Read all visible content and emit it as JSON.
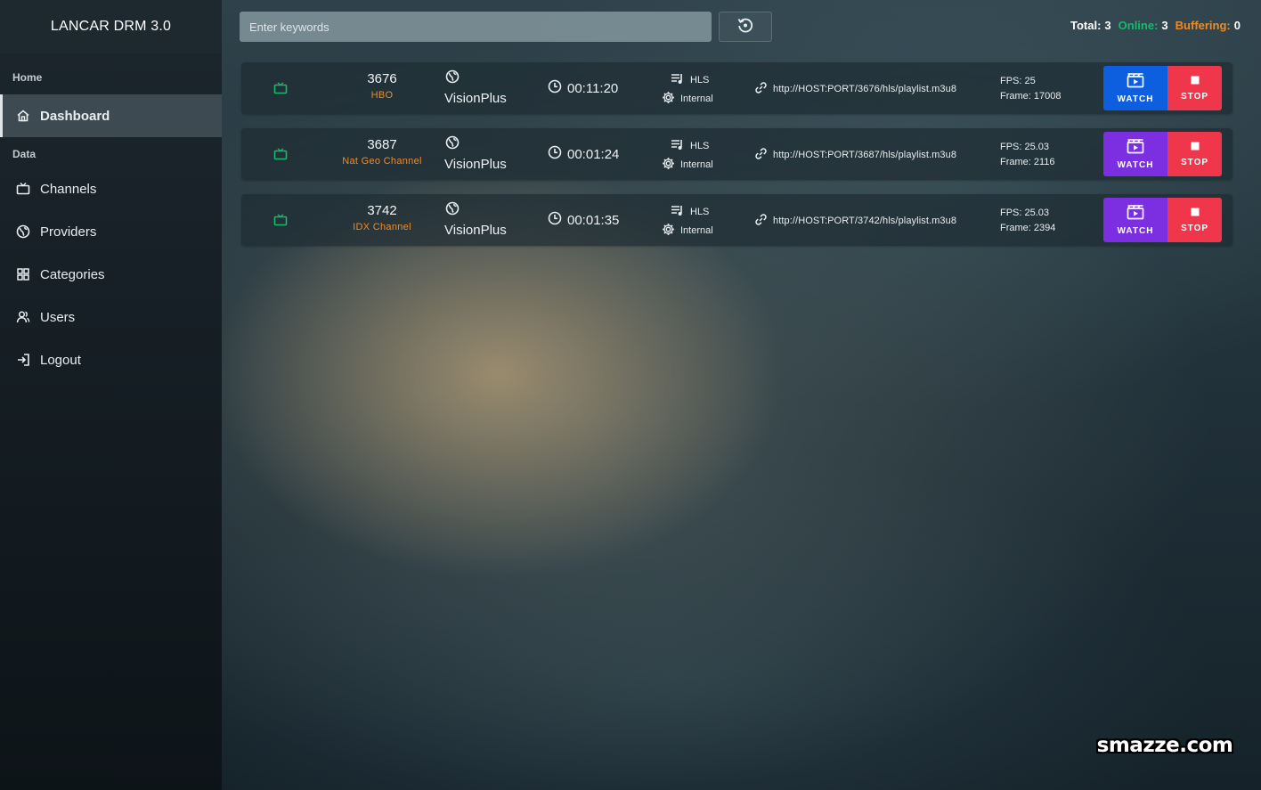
{
  "app": {
    "title": "LANCAR DRM 3.0"
  },
  "sidebar": {
    "sections": [
      {
        "label": "Home"
      },
      {
        "label": "Data"
      }
    ],
    "items": [
      {
        "label": "Dashboard",
        "icon": "home-icon",
        "active": true
      },
      {
        "label": "Channels",
        "icon": "tv-icon"
      },
      {
        "label": "Providers",
        "icon": "globe-icon"
      },
      {
        "label": "Categories",
        "icon": "grid-icon"
      },
      {
        "label": "Users",
        "icon": "users-icon"
      },
      {
        "label": "Logout",
        "icon": "logout-icon"
      }
    ]
  },
  "search": {
    "placeholder": "Enter keywords",
    "value": ""
  },
  "stats": {
    "total_label": "Total:",
    "total": "3",
    "online_label": "Online:",
    "online": "3",
    "buffering_label": "Buffering:",
    "buffering": "0"
  },
  "streams": [
    {
      "id": "3676",
      "channel": "HBO",
      "provider": "VisionPlus",
      "uptime": "00:11:20",
      "format": "HLS",
      "source": "Internal",
      "url": "http://HOST:PORT/3676/hls/playlist.m3u8",
      "fps": "FPS: 25",
      "frame": "Frame: 17008",
      "watch_label": "WATCH",
      "stop_label": "STOP",
      "watch_color": "#0d5fe0"
    },
    {
      "id": "3687",
      "channel": "Nat Geo Channel",
      "provider": "VisionPlus",
      "uptime": "00:01:24",
      "format": "HLS",
      "source": "Internal",
      "url": "http://HOST:PORT/3687/hls/playlist.m3u8",
      "fps": "FPS: 25.03",
      "frame": "Frame: 2116",
      "watch_label": "WATCH",
      "stop_label": "STOP",
      "watch_color": "#7b2fe0"
    },
    {
      "id": "3742",
      "channel": "IDX Channel",
      "provider": "VisionPlus",
      "uptime": "00:01:35",
      "format": "HLS",
      "source": "Internal",
      "url": "http://HOST:PORT/3742/hls/playlist.m3u8",
      "fps": "FPS: 25.03",
      "frame": "Frame: 2394",
      "watch_label": "WATCH",
      "stop_label": "STOP",
      "watch_color": "#7b2fe0"
    }
  ],
  "colors": {
    "online": "#17b96b",
    "buffering": "#f08a24",
    "stop": "#f0364a",
    "status_icon": "#17b96b"
  },
  "watermark": "smazze.com"
}
